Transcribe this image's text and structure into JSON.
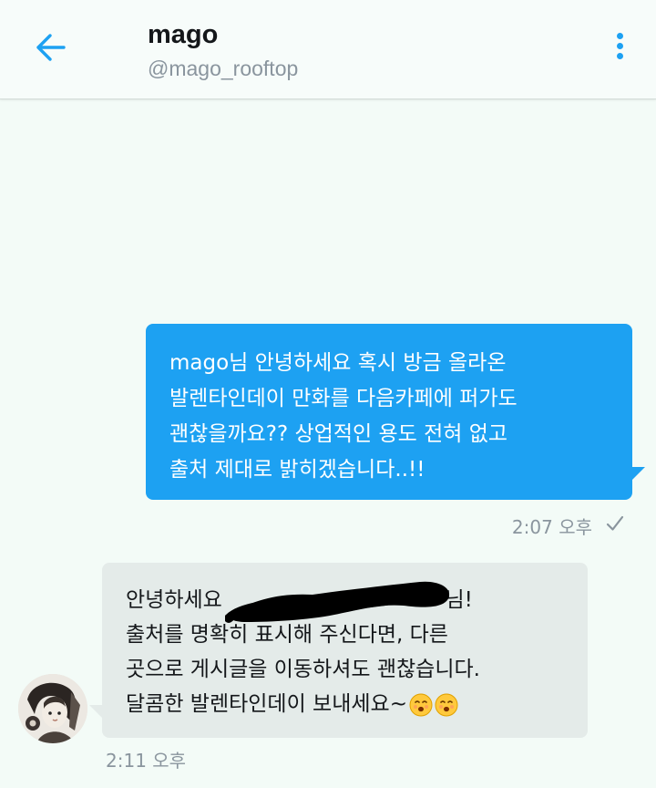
{
  "header": {
    "display_name": "mago",
    "handle": "@mago_rooftop"
  },
  "sent_message": {
    "lines": [
      "mago님 안녕하세요 혹시 방금 올라온",
      "발렌타인데이 만화를 다음카페에 퍼가도",
      "괜찮을까요?? 상업적인 용도 전혀 없고",
      "출처 제대로 밝히겠습니다..!!"
    ],
    "time": "2:07 오후"
  },
  "received_message": {
    "line1_start": "안녕하세요",
    "line1_end": "님!",
    "lines": [
      "출처를 명확히 표시해 주신다면, 다른",
      "곳으로 게시글을 이동하셔도 괜찮습니다.",
      "달콤한 발렌타인데이 보내세요~"
    ],
    "time": "2:11 오후"
  },
  "colors": {
    "accent": "#1da1f2",
    "sent_bubble": "#1da1f2",
    "received_bubble": "#e4ebe9",
    "background": "#f3fbf7",
    "meta_text": "#8a959e"
  },
  "icons": {
    "back": "arrow-left-icon",
    "more": "more-vertical-icon",
    "delivered": "check-icon",
    "emoji": "smiling-face-emoji"
  }
}
